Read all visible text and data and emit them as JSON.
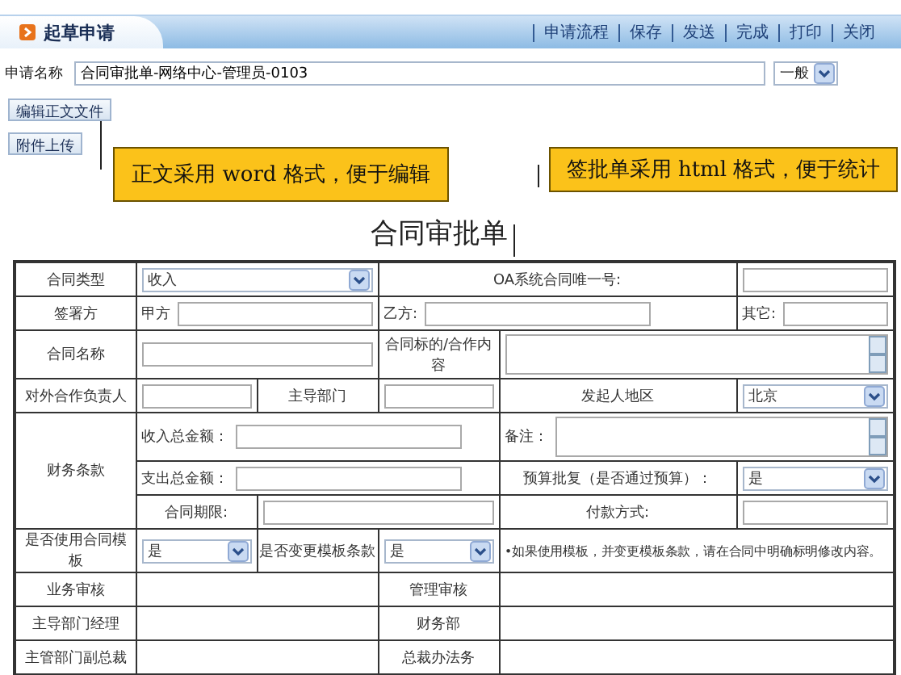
{
  "header": {
    "title": "起草申请",
    "actions": [
      "申请流程",
      "保存",
      "发送",
      "完成",
      "打印",
      "关闭"
    ]
  },
  "name_field": {
    "label": "申请名称",
    "value": "合同审批单-网络中心-管理员-0103",
    "priority": "一般"
  },
  "buttons": [
    "编辑正文文件",
    "附件上传"
  ],
  "callouts": [
    "正文采用 word 格式，便于编辑",
    "签批单采用 html 格式，便于统计"
  ],
  "form_title": "合同审批单",
  "table": {
    "rows": [
      [
        {
          "kind": "label",
          "text": "合同类型"
        },
        {
          "kind": "select",
          "value": "收入",
          "colspan": 2
        },
        {
          "kind": "label",
          "text": "OA系统合同唯一号:",
          "colspan": 2
        },
        {
          "kind": "input"
        }
      ],
      [
        {
          "kind": "label",
          "text": "签署方"
        },
        {
          "kind": "labeled_input",
          "text": "甲方",
          "colspan": 2
        },
        {
          "kind": "labeled_input",
          "text": "乙方:",
          "colspan": 2
        },
        {
          "kind": "labeled_input",
          "text": "其它:"
        }
      ],
      [
        {
          "kind": "label",
          "text": "合同名称"
        },
        {
          "kind": "input",
          "colspan": 2
        },
        {
          "kind": "label",
          "text": "合同标的/合作内容"
        },
        {
          "kind": "textarea",
          "colspan": 2
        }
      ],
      [
        {
          "kind": "label",
          "text": "对外合作负责人"
        },
        {
          "kind": "input"
        },
        {
          "kind": "label",
          "text": "主导部门"
        },
        {
          "kind": "input"
        },
        {
          "kind": "label",
          "text": "发起人地区"
        },
        {
          "kind": "select",
          "value": "北京"
        }
      ],
      [
        {
          "kind": "label",
          "text": "财务条款",
          "rowspan": 3
        },
        {
          "kind": "labeled_input",
          "text": "收入总金额：",
          "colspan": 3
        },
        {
          "kind": "labeled_textarea",
          "text": "备注：",
          "colspan": 2
        }
      ],
      [
        {
          "kind": "labeled_input",
          "text": "支出总金额：",
          "colspan": 3
        },
        {
          "kind": "label",
          "text": "预算批复（是否通过预算）："
        },
        {
          "kind": "select",
          "value": "是"
        }
      ],
      [
        {
          "kind": "label",
          "text": "合同期限:"
        },
        {
          "kind": "input",
          "colspan": 2
        },
        {
          "kind": "label",
          "text": "付款方式:"
        },
        {
          "kind": "input"
        }
      ],
      [
        {
          "kind": "label",
          "text": "是否使用合同模板"
        },
        {
          "kind": "select",
          "value": "是"
        },
        {
          "kind": "label",
          "text": "是否变更模板条款"
        },
        {
          "kind": "select",
          "value": "是"
        },
        {
          "kind": "note",
          "text": "•如果使用模板，并变更模板条款，请在合同中明确标明修改内容。",
          "colspan": 2
        }
      ],
      [
        {
          "kind": "label",
          "text": "业务审核"
        },
        {
          "kind": "empty",
          "colspan": 2
        },
        {
          "kind": "label",
          "text": "管理审核"
        },
        {
          "kind": "empty",
          "colspan": 2
        }
      ],
      [
        {
          "kind": "label",
          "text": "主导部门经理"
        },
        {
          "kind": "empty",
          "colspan": 2
        },
        {
          "kind": "label",
          "text": "财务部"
        },
        {
          "kind": "empty",
          "colspan": 2
        }
      ],
      [
        {
          "kind": "label",
          "text": "主管部门副总裁"
        },
        {
          "kind": "empty",
          "colspan": 2
        },
        {
          "kind": "label",
          "text": "总裁办法务"
        },
        {
          "kind": "empty",
          "colspan": 2
        }
      ]
    ]
  }
}
